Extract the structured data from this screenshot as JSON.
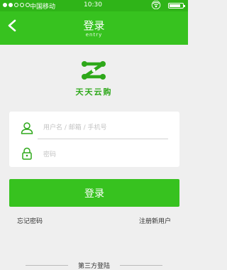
{
  "status_bar": {
    "carrier": "中国移动",
    "time": "10:30",
    "wifi_icon": "wifi-icon",
    "signal_bars": 5,
    "signal_filled": 2,
    "battery_level": 0.85
  },
  "nav": {
    "back_icon": "chevron-left-icon",
    "title": "登录",
    "subtitle": "entry"
  },
  "brand": {
    "logo_icon": "tiantianyungou-logo-icon",
    "name": "天天云购",
    "color": "#2ea81a"
  },
  "form": {
    "username_icon": "user-icon",
    "username_placeholder": "用户名 / 邮箱 / 手机号",
    "username_value": "",
    "password_icon": "lock-icon",
    "password_placeholder": "密码",
    "password_value": ""
  },
  "actions": {
    "login_label": "登录",
    "forgot_label": "忘记密码",
    "register_label": "注册新用户"
  },
  "third_party": {
    "label": "第三方登陆"
  },
  "colors": {
    "accent": "#37c21f",
    "status_bar": "#2fb418",
    "background": "#efefef"
  }
}
